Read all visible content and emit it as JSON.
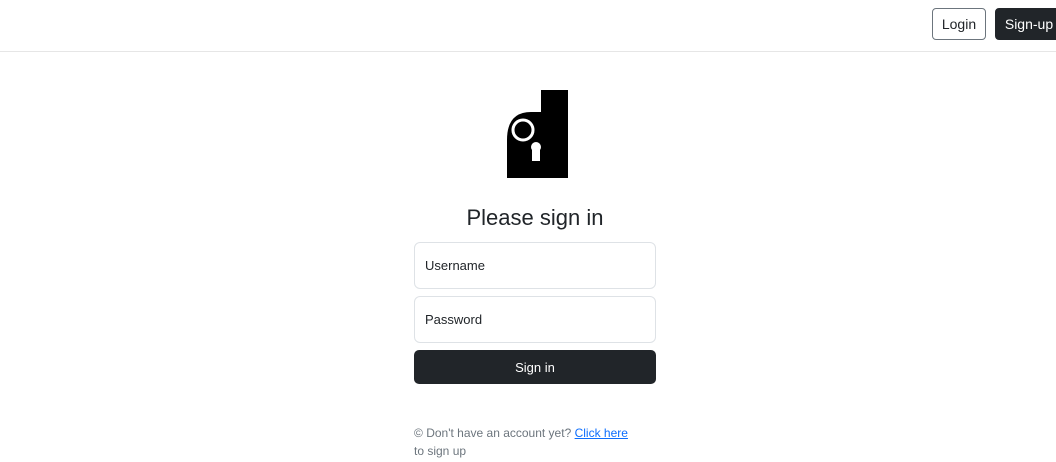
{
  "navbar": {
    "login_label": "Login",
    "signup_label": "Sign-up"
  },
  "logo": {
    "icon": "building-keyhole-logo",
    "color": "#000000"
  },
  "form": {
    "heading": "Please sign in",
    "username_placeholder": "Username",
    "password_placeholder": "Password",
    "submit_label": "Sign in"
  },
  "footer": {
    "copyright_symbol": "©",
    "prompt_text": "Don't have an account yet?",
    "link_text": "Click here",
    "suffix_text": "to sign up"
  },
  "colors": {
    "primary_dark": "#212529",
    "link": "#0d6efd",
    "muted": "#6c757d"
  }
}
